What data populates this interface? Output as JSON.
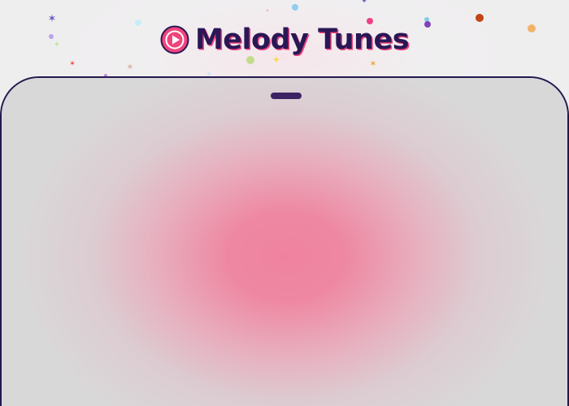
{
  "app": {
    "brand_name": "Melody Tunes"
  },
  "icons": {
    "logo": "play-circle-icon",
    "notch": "speaker-notch"
  },
  "colors": {
    "brand_text": "#2a1756",
    "brand_shadow": "#f0447c",
    "logo_fill": "#f0447c",
    "device_border": "#22194f",
    "device_bg": "#d9d8d9",
    "screen_glow": "#ef82a0",
    "notch": "#3b2364"
  }
}
